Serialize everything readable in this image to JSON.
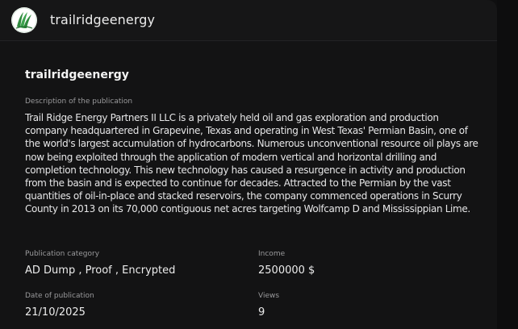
{
  "header": {
    "title": "trailridgeenergy",
    "logo_icon": "trail-ridge-leaf-logo"
  },
  "publication": {
    "name": "trailridgeenergy",
    "description_label": "Description of the publication",
    "description": "Trail Ridge Energy Partners II LLC is a privately held oil and gas exploration and production company headquartered in Grapevine, Texas and operating in West Texas' Permian Basin, one of the world's largest accumulation of hydrocarbons. Numerous unconventional resource oil plays are now being exploited through the application of modern vertical and horizontal drilling and completion technology. This new technology has caused a resurgence in activity and production from the basin and is expected to continue for decades. Attracted to the Permian by the vast quantities of oil-in-place and stacked reservoirs, the company commenced operations in Scurry County in 2013 on its 70,000 contiguous net acres targeting Wolfcamp D and Mississippian Lime.",
    "category_label": "Publication category",
    "category": "AD Dump , Proof , Encrypted",
    "income_label": "Income",
    "income": "2500000 $",
    "date_label": "Date of publication",
    "date": "21/10/2025",
    "views_label": "Views",
    "views": "9"
  },
  "colors": {
    "background": "#131314",
    "header": "#161617",
    "label": "#9a9a9c",
    "text": "#ececec",
    "logo_green": "#2f8a3e"
  }
}
